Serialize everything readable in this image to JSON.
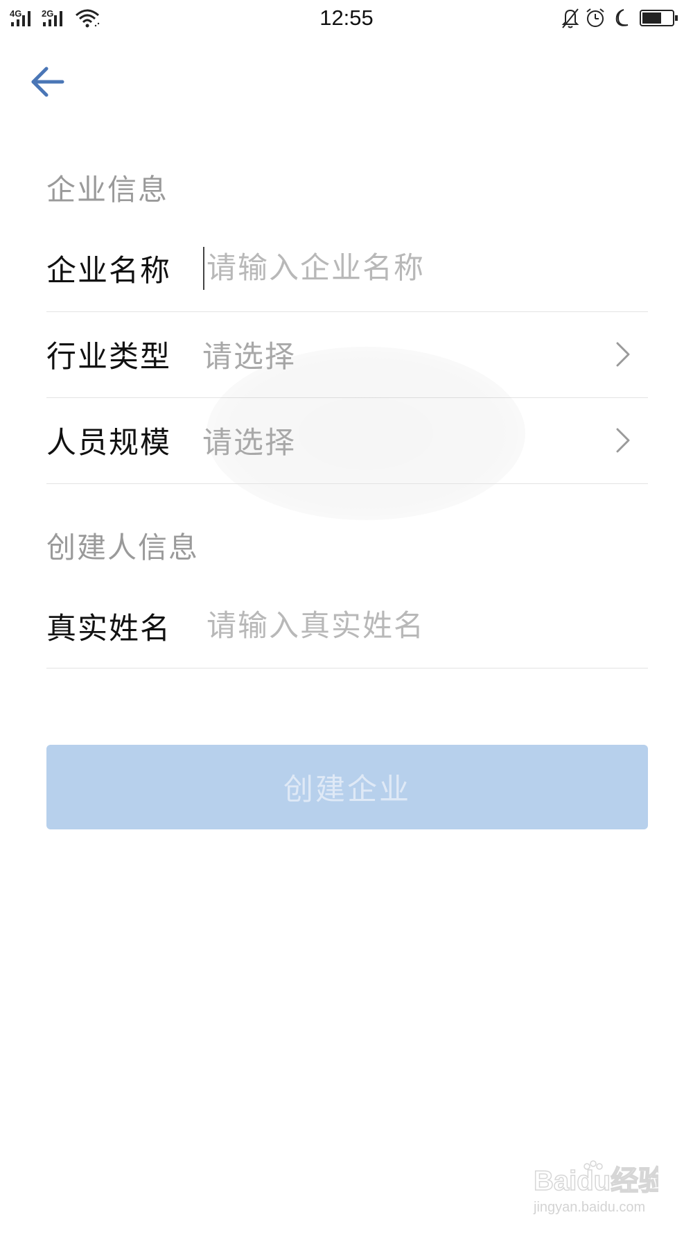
{
  "status_bar": {
    "network_1": "4G",
    "network_2": "2G",
    "time": "12:55"
  },
  "sections": {
    "company_info_title": "企业信息",
    "creator_info_title": "创建人信息"
  },
  "form": {
    "company_name": {
      "label": "企业名称",
      "placeholder": "请输入企业名称",
      "value": ""
    },
    "industry_type": {
      "label": "行业类型",
      "value": "请选择"
    },
    "staff_size": {
      "label": "人员规模",
      "value": "请选择"
    },
    "real_name": {
      "label": "真实姓名",
      "placeholder": "请输入真实姓名",
      "value": ""
    }
  },
  "actions": {
    "create_label": "创建企业"
  },
  "watermark": {
    "brand_text": "Baidu经验",
    "url_text": "jingyan.baidu.com"
  },
  "colors": {
    "accent": "#4a76b6",
    "button_disabled_bg": "#b7d0ec",
    "placeholder": "#b8b8b8",
    "section_title": "#9a9a9a"
  },
  "icons": {
    "back": "arrow-left-icon",
    "chevron": "chevron-right-icon",
    "signal": "signal-icon",
    "wifi": "wifi-icon",
    "bell_off": "bell-off-icon",
    "alarm": "alarm-icon",
    "moon": "moon-icon",
    "battery": "battery-icon"
  }
}
